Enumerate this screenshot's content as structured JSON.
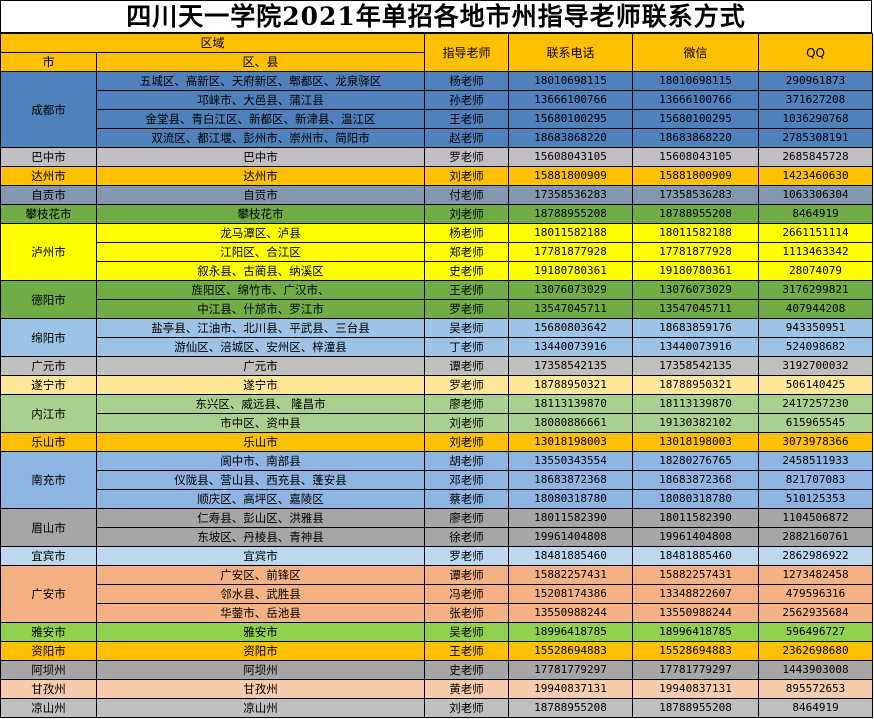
{
  "title": "四川天一学院2021年单招各地市州指导老师联系方式",
  "header": {
    "region": "区域",
    "city": "市",
    "district": "区、县",
    "teacher": "指导老师",
    "phone": "联系电话",
    "wechat": "微信",
    "qq": "QQ"
  },
  "colors": {
    "header_bg": "#ffc000",
    "blue_dark": "#4f81bd",
    "gray": "#bfbfbf",
    "orange": "#ffc000",
    "slate": "#8497b0",
    "green": "#70ad47",
    "yellow": "#ffff00",
    "light_blue": "#9dc3e6",
    "light_yellow": "#ffe699",
    "light_green": "#a9d08e",
    "mid_blue": "#8eb4e3",
    "dark_gray": "#a6a6a6",
    "pale_blue": "#bdd7ee",
    "salmon": "#f4b183",
    "light_lime": "#92d050",
    "peach": "#f8cbad"
  },
  "groups": [
    {
      "city": "成都市",
      "color": "#4f81bd",
      "rows": [
        {
          "district": "五城区、高新区、天府新区、郫都区、龙泉驿区",
          "teacher": "杨老师",
          "phone": "18010698115",
          "wechat": "18010698115",
          "qq": "290961873"
        },
        {
          "district": "邛崃市、大邑县、蒲江县",
          "teacher": "孙老师",
          "phone": "13666100766",
          "wechat": "13666100766",
          "qq": "371627208"
        },
        {
          "district": "金堂县、青白江区、新都区、新津县、温江区",
          "teacher": "王老师",
          "phone": "15680100295",
          "wechat": "15680100295",
          "qq": "1036290768"
        },
        {
          "district": "双流区、都江堰、彭州市、崇州市、简阳市",
          "teacher": "赵老师",
          "phone": "18683868220",
          "wechat": "18683868220",
          "qq": "2785308191"
        }
      ]
    },
    {
      "city": "巴中市",
      "color": "#bfbfbf",
      "rows": [
        {
          "district": "巴中市",
          "teacher": "罗老师",
          "phone": "15608043105",
          "wechat": "15608043105",
          "qq": "2685845728"
        }
      ]
    },
    {
      "city": "达州市",
      "color": "#ffc000",
      "rows": [
        {
          "district": "达州市",
          "teacher": "刘老师",
          "phone": "15881800909",
          "wechat": "15881800909",
          "qq": "1423460630"
        }
      ]
    },
    {
      "city": "自贡市",
      "color": "#8497b0",
      "rows": [
        {
          "district": "自贡市",
          "teacher": "付老师",
          "phone": "17358536283",
          "wechat": "17358536283",
          "qq": "1063306304"
        }
      ]
    },
    {
      "city": "攀枝花市",
      "color": "#70ad47",
      "rows": [
        {
          "district": "攀枝花市",
          "teacher": "刘老师",
          "phone": "18788955208",
          "wechat": "18788955208",
          "qq": "8464919"
        }
      ]
    },
    {
      "city": "泸州市",
      "color": "#ffff00",
      "rows": [
        {
          "district": "龙马潭区、泸县",
          "teacher": "杨老师",
          "phone": "18011582188",
          "wechat": "18011582188",
          "qq": "2661151114"
        },
        {
          "district": "江阳区、合江区",
          "teacher": "郑老师",
          "phone": "17781877928",
          "wechat": "17781877928",
          "qq": "1113463342"
        },
        {
          "district": "叙永县、古蔺县、纳溪区",
          "teacher": "史老师",
          "phone": "19180780361",
          "wechat": "19180780361",
          "qq": "28074079"
        }
      ]
    },
    {
      "city": "德阳市",
      "color": "#70ad47",
      "rows": [
        {
          "district": "旌阳区、绵竹市、广汉市、",
          "teacher": "王老师",
          "phone": "13076073029",
          "wechat": "13076073029",
          "qq": "3176299821"
        },
        {
          "district": "中江县、什邡市、罗江市",
          "teacher": "罗老师",
          "phone": "13547045711",
          "wechat": "13547045711",
          "qq": "407944208"
        }
      ]
    },
    {
      "city": "绵阳市",
      "color": "#9dc3e6",
      "rows": [
        {
          "district": "盐亭县、江油市、北川县、平武县、三台县",
          "teacher": "吴老师",
          "phone": "15680803642",
          "wechat": "18683859176",
          "qq": "943350951"
        },
        {
          "district": "游仙区、涪城区、安州区、梓潼县",
          "teacher": "丁老师",
          "phone": "13440073916",
          "wechat": "13440073916",
          "qq": "524098682"
        }
      ]
    },
    {
      "city": "广元市",
      "color": "#bfbfbf",
      "rows": [
        {
          "district": "广元市",
          "teacher": "谭老师",
          "phone": "17358542135",
          "wechat": "17358542135",
          "qq": "3192700032"
        }
      ]
    },
    {
      "city": "遂宁市",
      "color": "#ffe699",
      "rows": [
        {
          "district": "遂宁市",
          "teacher": "罗老师",
          "phone": "18788950321",
          "wechat": "18788950321",
          "qq": "506140425"
        }
      ]
    },
    {
      "city": "内江市",
      "color": "#a9d08e",
      "rows": [
        {
          "district": "东兴区、威远县、 隆昌市",
          "teacher": "廖老师",
          "phone": "18113139870",
          "wechat": "18113139870",
          "qq": "2417257230"
        },
        {
          "district": "市中区、资中县",
          "teacher": "刘老师",
          "phone": "18080886661",
          "wechat": "19130382102",
          "qq": "615965545"
        }
      ]
    },
    {
      "city": "乐山市",
      "color": "#ffc000",
      "rows": [
        {
          "district": "乐山市",
          "teacher": "刘老师",
          "phone": "13018198003",
          "wechat": "13018198003",
          "qq": "3073978366"
        }
      ]
    },
    {
      "city": "南充市",
      "color": "#8eb4e3",
      "rows": [
        {
          "district": "阆中市、南部县",
          "teacher": "胡老师",
          "phone": "13550343554",
          "wechat": "18280276765",
          "qq": "2458511933"
        },
        {
          "district": "仪陇县、营山县、西充县、蓬安县",
          "teacher": "邓老师",
          "phone": "18683872368",
          "wechat": "18683872368",
          "qq": "821707083"
        },
        {
          "district": "顺庆区、高坪区、嘉陵区",
          "teacher": "蔡老师",
          "phone": "18080318780",
          "wechat": "18080318780",
          "qq": "510125353"
        }
      ]
    },
    {
      "city": "眉山市",
      "color": "#a6a6a6",
      "rows": [
        {
          "district": "仁寿县、彭山区、洪雅县",
          "teacher": "廖老师",
          "phone": "18011582390",
          "wechat": "18011582390",
          "qq": "1104506872"
        },
        {
          "district": "东坡区、丹棱县、青神县",
          "teacher": "徐老师",
          "phone": "19961404808",
          "wechat": "19961404808",
          "qq": "2882160761"
        }
      ]
    },
    {
      "city": "宜宾市",
      "color": "#bdd7ee",
      "rows": [
        {
          "district": "宜宾市",
          "teacher": "罗老师",
          "phone": "18481885460",
          "wechat": "18481885460",
          "qq": "2862986922"
        }
      ]
    },
    {
      "city": "广安市",
      "color": "#f4b183",
      "rows": [
        {
          "district": "广安区、前锋区",
          "teacher": "谭老师",
          "phone": "15882257431",
          "wechat": "15882257431",
          "qq": "1273482458"
        },
        {
          "district": "邻水县、武胜县",
          "teacher": "冯老师",
          "phone": "15208174386",
          "wechat": "13348822607",
          "qq": "479596316"
        },
        {
          "district": "华蓥市、岳池县",
          "teacher": "张老师",
          "phone": "13550988244",
          "wechat": "13550988244",
          "qq": "2562935684"
        }
      ]
    },
    {
      "city": "雅安市",
      "color": "#92d050",
      "rows": [
        {
          "district": "雅安市",
          "teacher": "吴老师",
          "phone": "18996418785",
          "wechat": "18996418785",
          "qq": "596496727"
        }
      ]
    },
    {
      "city": "资阳市",
      "color": "#ffc000",
      "rows": [
        {
          "district": "资阳市",
          "teacher": "王老师",
          "phone": "15528694883",
          "wechat": "15528694883",
          "qq": "2362698680"
        }
      ]
    },
    {
      "city": "阿坝州",
      "color": "#a6a6a6",
      "rows": [
        {
          "district": "阿坝州",
          "teacher": "史老师",
          "phone": "17781779297",
          "wechat": "17781779297",
          "qq": "1443903008"
        }
      ]
    },
    {
      "city": "甘孜州",
      "color": "#f8cbad",
      "rows": [
        {
          "district": "甘孜州",
          "teacher": "黄老师",
          "phone": "19940837131",
          "wechat": "19940837131",
          "qq": "895572653"
        }
      ]
    },
    {
      "city": "凉山州",
      "color": "#bfbfbf",
      "rows": [
        {
          "district": "凉山州",
          "teacher": "刘老师",
          "phone": "18788955208",
          "wechat": "18788955208",
          "qq": "8464919"
        }
      ]
    }
  ]
}
